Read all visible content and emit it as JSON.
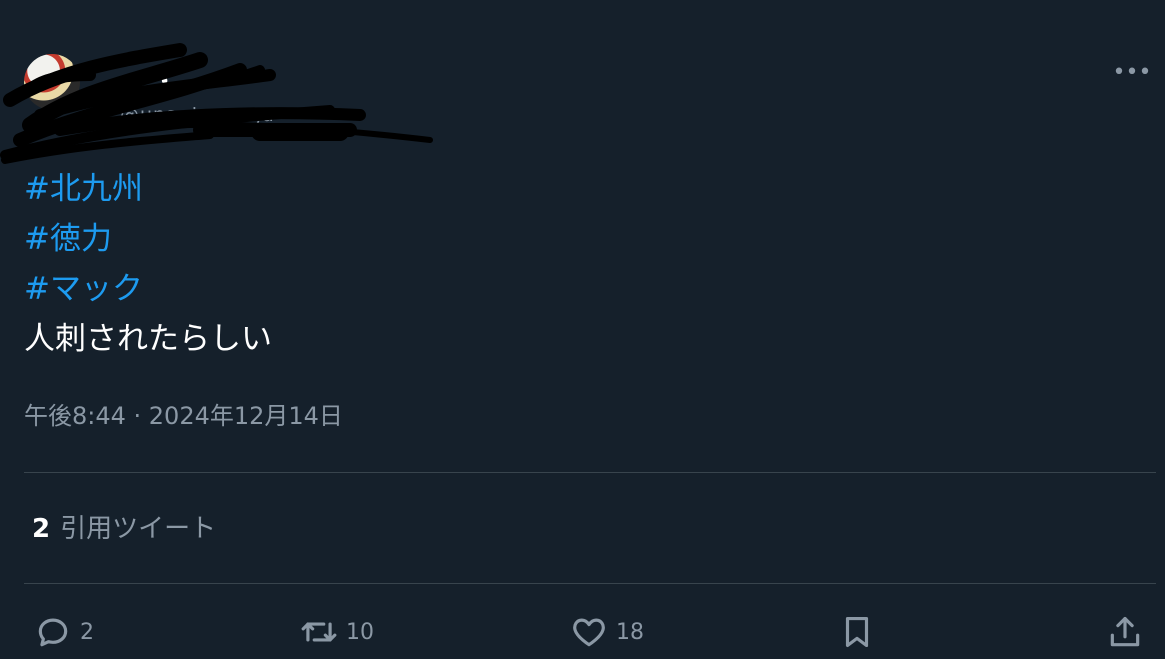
{
  "author": {
    "display_name": "ー ・",
    "handle": "@unagiaagaga"
  },
  "tweet": {
    "hashtags": [
      "#北九州",
      "#徳力",
      "#マック"
    ],
    "text": "人刺されたらしい",
    "timestamp": "午後8:44 · 2024年12月14日"
  },
  "quotes": {
    "count": "2",
    "label": "引用ツイート"
  },
  "actions": {
    "reply_count": "2",
    "retweet_count": "10",
    "like_count": "18"
  },
  "colors": {
    "background": "#15202b",
    "hashtag": "#1d9bf0",
    "secondary_text": "#8b98a5",
    "divider": "#38444d"
  },
  "icons": {
    "more": "more-horizontal-icon",
    "reply": "reply-icon",
    "retweet": "retweet-icon",
    "like": "heart-icon",
    "bookmark": "bookmark-icon",
    "share": "share-icon"
  }
}
